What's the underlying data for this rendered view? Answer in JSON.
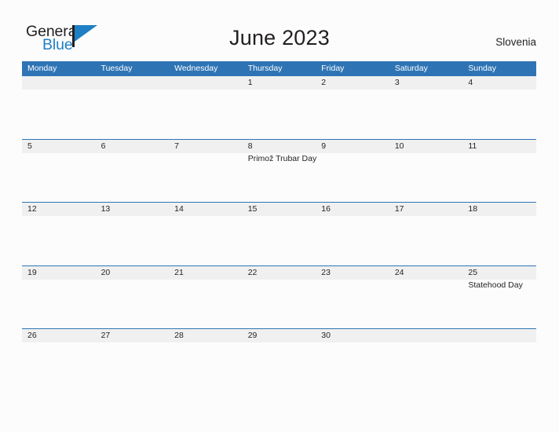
{
  "brand": {
    "name_part1": "General",
    "name_part2": "Blue",
    "logo_icon": "flag-triangle-icon",
    "color_dark": "#231f20",
    "color_blue": "#1f7fc4"
  },
  "header": {
    "title": "June 2023",
    "country": "Slovenia"
  },
  "colors": {
    "header_blue": "#2e74b5",
    "row_band": "#f0f0f0",
    "page_background": "#fcfcfc",
    "text": "#231f20"
  },
  "calendar": {
    "weekdays": [
      "Monday",
      "Tuesday",
      "Wednesday",
      "Thursday",
      "Friday",
      "Saturday",
      "Sunday"
    ],
    "weeks": [
      [
        {
          "day": "",
          "event": ""
        },
        {
          "day": "",
          "event": ""
        },
        {
          "day": "",
          "event": ""
        },
        {
          "day": "1",
          "event": ""
        },
        {
          "day": "2",
          "event": ""
        },
        {
          "day": "3",
          "event": ""
        },
        {
          "day": "4",
          "event": ""
        }
      ],
      [
        {
          "day": "5",
          "event": ""
        },
        {
          "day": "6",
          "event": ""
        },
        {
          "day": "7",
          "event": ""
        },
        {
          "day": "8",
          "event": "Primož Trubar Day"
        },
        {
          "day": "9",
          "event": ""
        },
        {
          "day": "10",
          "event": ""
        },
        {
          "day": "11",
          "event": ""
        }
      ],
      [
        {
          "day": "12",
          "event": ""
        },
        {
          "day": "13",
          "event": ""
        },
        {
          "day": "14",
          "event": ""
        },
        {
          "day": "15",
          "event": ""
        },
        {
          "day": "16",
          "event": ""
        },
        {
          "day": "17",
          "event": ""
        },
        {
          "day": "18",
          "event": ""
        }
      ],
      [
        {
          "day": "19",
          "event": ""
        },
        {
          "day": "20",
          "event": ""
        },
        {
          "day": "21",
          "event": ""
        },
        {
          "day": "22",
          "event": ""
        },
        {
          "day": "23",
          "event": ""
        },
        {
          "day": "24",
          "event": ""
        },
        {
          "day": "25",
          "event": "Statehood Day"
        }
      ],
      [
        {
          "day": "26",
          "event": ""
        },
        {
          "day": "27",
          "event": ""
        },
        {
          "day": "28",
          "event": ""
        },
        {
          "day": "29",
          "event": ""
        },
        {
          "day": "30",
          "event": ""
        },
        {
          "day": "",
          "event": ""
        },
        {
          "day": "",
          "event": ""
        }
      ]
    ]
  }
}
